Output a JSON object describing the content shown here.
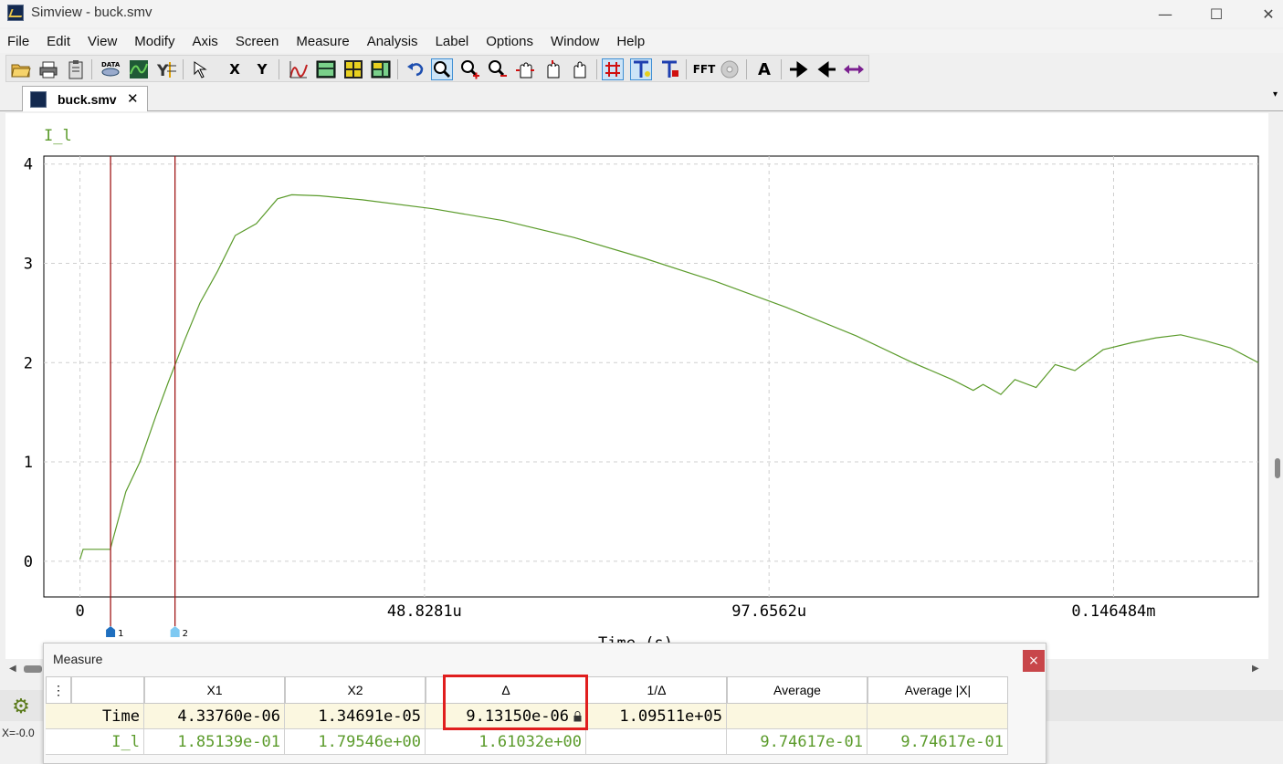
{
  "window": {
    "title": "Simview - buck.smv",
    "minimize": "—",
    "maximize": "☐",
    "close": "✕"
  },
  "menu": [
    "File",
    "Edit",
    "View",
    "Modify",
    "Axis",
    "Screen",
    "Measure",
    "Analysis",
    "Label",
    "Options",
    "Window",
    "Help"
  ],
  "toolbar": {
    "x_label": "X",
    "y_label": "Y",
    "fft_label": "FFT",
    "text_label": "A"
  },
  "tab": {
    "label": "buck.smv",
    "close": "✕"
  },
  "plot": {
    "signal_label": "I_l",
    "xlabel": "Time (s)",
    "x_ticks": [
      "0",
      "48.8281u",
      "97.6562u",
      "0.146484m"
    ],
    "y_ticks": [
      "4",
      "3",
      "2",
      "1",
      "0"
    ],
    "cursor1": "1",
    "cursor2": "2"
  },
  "chart_data": {
    "type": "line",
    "xlabel": "Time (s)",
    "ylabel": "",
    "xlim": [
      -5.12e-06,
      0.000167
    ],
    "ylim": [
      -0.36,
      4.08
    ],
    "x_tick_values": [
      0,
      4.88281e-05,
      9.76562e-05,
      0.000146484
    ],
    "y_tick_values": [
      0,
      1,
      2,
      3,
      4
    ],
    "grid": true,
    "series": [
      {
        "name": "I_l",
        "color": "#5b9b2b",
        "x": [
          0,
          4.5e-07,
          4.3e-06,
          4.6e-06,
          6.5e-06,
          8.5e-06,
          1.08e-05,
          1.25e-05,
          1.48e-05,
          1.7e-05,
          1.95e-05,
          2.2e-05,
          2.5e-05,
          2.8e-05,
          3e-05,
          3.4e-05,
          4e-05,
          5e-05,
          6e-05,
          7e-05,
          8e-05,
          9e-05,
          0.0001,
          0.00011,
          0.000118,
          0.0001236,
          0.0001266,
          0.000128,
          0.0001305,
          0.0001325,
          0.0001355,
          0.0001382,
          0.000141,
          0.000145,
          0.000149,
          0.0001525,
          0.000156,
          0.0001595,
          0.000163,
          0.000167
        ],
        "values": [
          0.02,
          0.12,
          0.12,
          0.2,
          0.7,
          1.0,
          1.47,
          1.8,
          2.22,
          2.6,
          2.92,
          3.28,
          3.4,
          3.65,
          3.69,
          3.68,
          3.64,
          3.55,
          3.43,
          3.26,
          3.05,
          2.82,
          2.56,
          2.27,
          2.0,
          1.83,
          1.72,
          1.78,
          1.68,
          1.83,
          1.75,
          1.98,
          1.92,
          2.13,
          2.2,
          2.25,
          2.28,
          2.22,
          2.15,
          2.0
        ]
      }
    ],
    "cursors": {
      "x1": 4.3376e-06,
      "x2": 1.34691e-05
    }
  },
  "measure": {
    "title": "Measure",
    "close": "×",
    "menu_icon": "⋮",
    "headers": [
      "X1",
      "X2",
      "Δ",
      "1/Δ",
      "Average",
      "Average |X|"
    ],
    "rows": [
      {
        "name": "Time",
        "x1": "4.33760e-06",
        "x2": "1.34691e-05",
        "delta": "9.13150e-06",
        "inv_delta": "1.09511e+05",
        "avg": "",
        "avg_abs": ""
      },
      {
        "name": "I_l",
        "x1": "1.85139e-01",
        "x2": "1.79546e+00",
        "delta": "1.61032e+00",
        "inv_delta": "",
        "avg": "9.74617e-01",
        "avg_abs": "9.74617e-01"
      }
    ]
  },
  "status": {
    "text": "X=-0.0"
  }
}
